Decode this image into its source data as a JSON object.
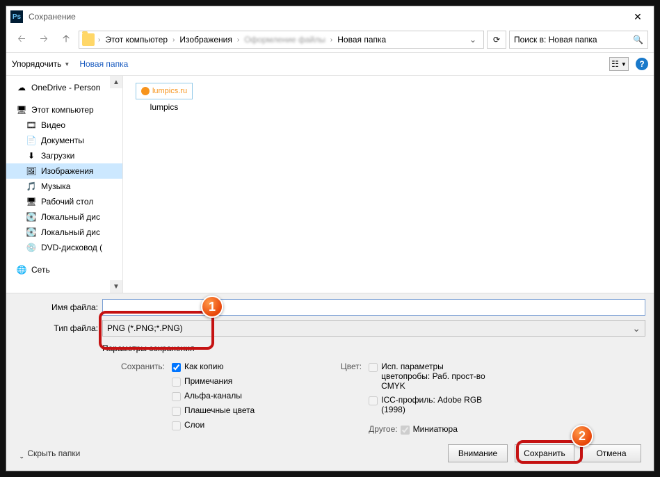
{
  "title": "Сохранение",
  "path": {
    "c1": "Этот компьютер",
    "c2": "Изображения",
    "c3_blur": "Оформление файлы",
    "c4": "Новая папка"
  },
  "search": {
    "placeholder": "Поиск в: Новая папка"
  },
  "toolbar": {
    "org": "Упорядочить",
    "newf": "Новая папка"
  },
  "tree": [
    {
      "label": "OneDrive - Person",
      "icon": "☁",
      "cls": ""
    },
    {
      "label": "Этот компьютер",
      "icon": "🖥",
      "cls": ""
    },
    {
      "label": "Видео",
      "icon": "🎞",
      "cls": "ind"
    },
    {
      "label": "Документы",
      "icon": "📄",
      "cls": "ind"
    },
    {
      "label": "Загрузки",
      "icon": "⬇",
      "cls": "ind"
    },
    {
      "label": "Изображения",
      "icon": "🖼",
      "cls": "ind sel"
    },
    {
      "label": "Музыка",
      "icon": "🎵",
      "cls": "ind"
    },
    {
      "label": "Рабочий стол",
      "icon": "🖥",
      "cls": "ind"
    },
    {
      "label": "Локальный дис",
      "icon": "💽",
      "cls": "ind"
    },
    {
      "label": "Локальный дис",
      "icon": "💽",
      "cls": "ind"
    },
    {
      "label": "DVD-дисковод (",
      "icon": "💿",
      "cls": "ind"
    },
    {
      "label": "Сеть",
      "icon": "🌐",
      "cls": ""
    }
  ],
  "file": {
    "thumb": "lumpics.ru",
    "name": "lumpics"
  },
  "fname": {
    "lbl": "Имя файла:",
    "val": ""
  },
  "ftype": {
    "lbl": "Тип файла:",
    "val": "PNG (*.PNG;*.PNG)"
  },
  "params": "Параметры сохранения",
  "save_lbl": "Сохранить:",
  "chk": {
    "copy": "Как копию",
    "notes": "Примечания",
    "alpha": "Альфа-каналы",
    "spot": "Плашечные цвета",
    "layers": "Слои"
  },
  "color_lbl": "Цвет:",
  "icc1": "Исп. параметры цветопробы:  Раб. прост-во CMYK",
  "icc2": "ICC-профиль:  Adobe RGB (1998)",
  "other_lbl": "Другое:",
  "thumb_chk": "Миниатюра",
  "btn": {
    "warn": "Внимание",
    "save": "Сохранить",
    "cancel": "Отмена"
  },
  "hide": "Скрыть папки"
}
